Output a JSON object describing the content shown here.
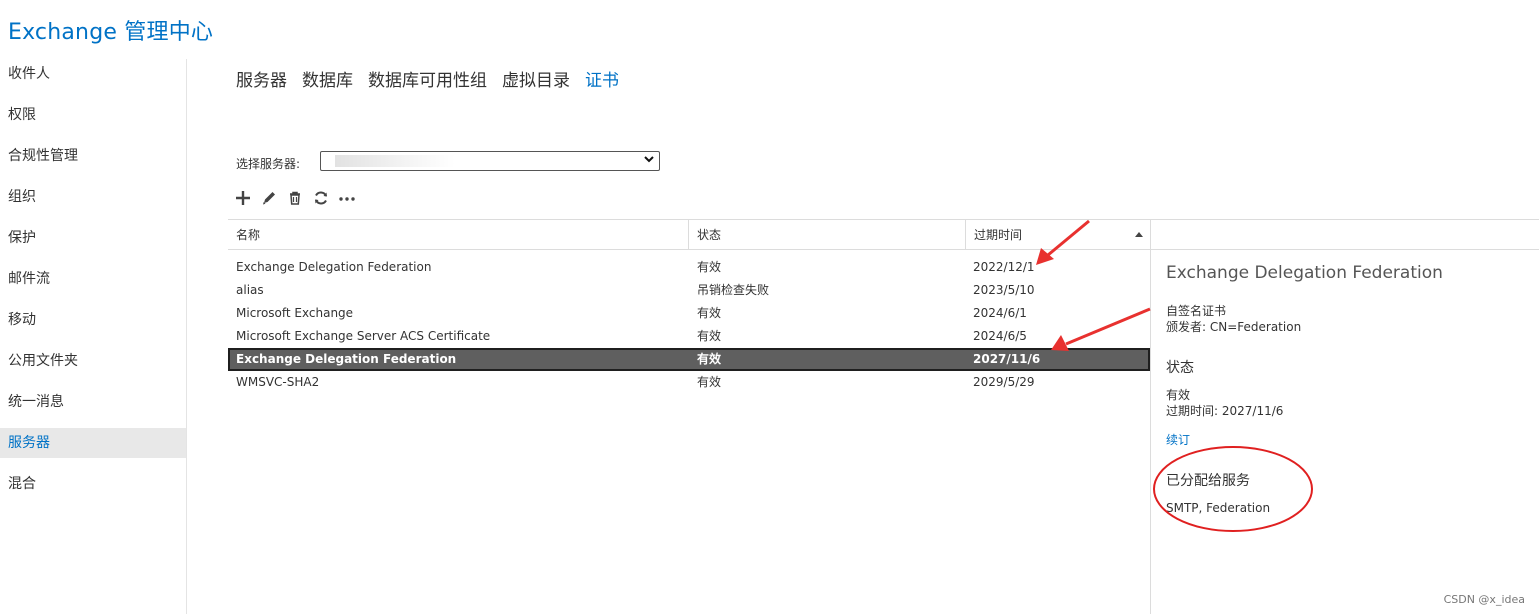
{
  "app": {
    "title": "Exchange 管理中心"
  },
  "sidebar": {
    "items": [
      {
        "label": "收件人"
      },
      {
        "label": "权限"
      },
      {
        "label": "合规性管理"
      },
      {
        "label": "组织"
      },
      {
        "label": "保护"
      },
      {
        "label": "邮件流"
      },
      {
        "label": "移动"
      },
      {
        "label": "公用文件夹"
      },
      {
        "label": "统一消息"
      },
      {
        "label": "服务器"
      },
      {
        "label": "混合"
      }
    ],
    "active_index": 9
  },
  "tabs": [
    {
      "label": "服务器"
    },
    {
      "label": "数据库"
    },
    {
      "label": "数据库可用性组"
    },
    {
      "label": "虚拟目录"
    },
    {
      "label": "证书"
    }
  ],
  "active_tab_index": 4,
  "server_select": {
    "label": "选择服务器:"
  },
  "toolbar": {
    "add_icon": "plus-icon",
    "edit_icon": "pencil-icon",
    "delete_icon": "trash-icon",
    "refresh_icon": "refresh-icon",
    "more_icon": "more-icon"
  },
  "table": {
    "columns": [
      "名称",
      "状态",
      "过期时间"
    ],
    "sort_column": "过期时间",
    "rows": [
      {
        "name": "Exchange Delegation Federation",
        "status": "有效",
        "expires": "2022/12/1"
      },
      {
        "name": "alias",
        "status": "吊销检查失败",
        "expires": "2023/5/10"
      },
      {
        "name": "Microsoft Exchange",
        "status": "有效",
        "expires": "2024/6/1"
      },
      {
        "name": "Microsoft Exchange Server ACS Certificate",
        "status": "有效",
        "expires": "2024/6/5"
      },
      {
        "name": "Exchange Delegation Federation",
        "status": "有效",
        "expires": "2027/11/6"
      },
      {
        "name": "WMSVC-SHA2",
        "status": "有效",
        "expires": "2029/5/29"
      }
    ],
    "selected_index": 4
  },
  "detail": {
    "title": "Exchange Delegation Federation",
    "type": "自签名证书",
    "issuer": "颁发者: CN=Federation",
    "status_heading": "状态",
    "status_value": "有效",
    "expires": "过期时间: 2027/11/6",
    "renew_link": "续订",
    "services_heading": "已分配给服务",
    "services": "SMTP, Federation"
  },
  "colors": {
    "accent": "#0072c6",
    "selected_row": "#5f5f5f",
    "annotation_arrow": "#e8312f",
    "annotation_circle": "#e02020"
  },
  "watermark": "CSDN @x_idea"
}
